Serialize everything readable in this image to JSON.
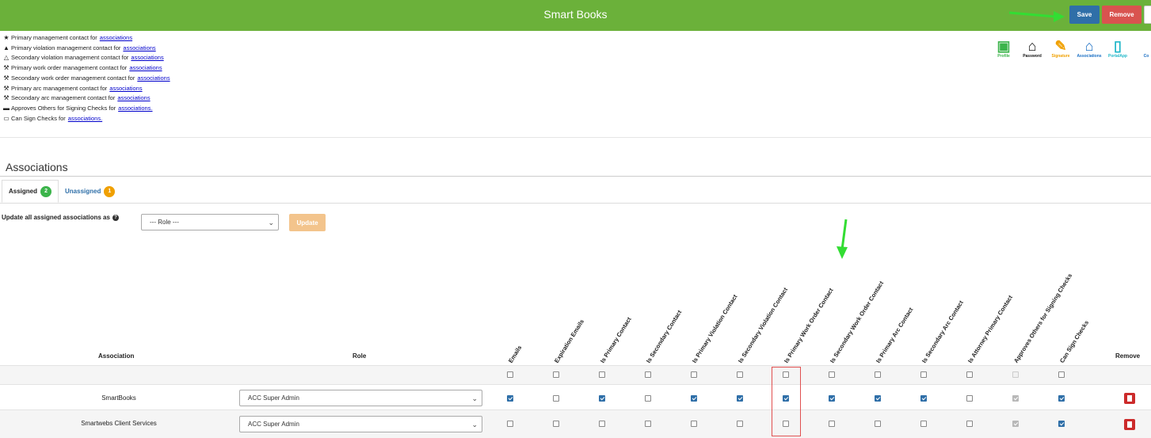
{
  "header": {
    "title": "Smart Books",
    "save_label": "Save",
    "remove_label": "Remove",
    "bg_color": "#6bb13a"
  },
  "legend": [
    {
      "icon": "star-icon",
      "text": "Primary management contact for",
      "link": "associations"
    },
    {
      "icon": "warning-filled-icon",
      "text": "Primary violation management contact for",
      "link": "associations"
    },
    {
      "icon": "warning-outline-icon",
      "text": "Secondary violation management contact for",
      "link": "associations"
    },
    {
      "icon": "wrench-filled-icon",
      "text": "Primary work order management contact for",
      "link": "associations"
    },
    {
      "icon": "wrench-outline-icon",
      "text": "Secondary work order management contact for",
      "link": "associations"
    },
    {
      "icon": "hammer-filled-icon",
      "text": "Primary arc management contact for",
      "link": "associations"
    },
    {
      "icon": "hammer-outline-icon",
      "text": "Secondary arc management contact for",
      "link": "associations"
    },
    {
      "icon": "money-icon",
      "text": "Approves Others for Signing Checks for",
      "link": "associations."
    },
    {
      "icon": "check-card-icon",
      "text": "Can Sign Checks for",
      "link": "associations."
    }
  ],
  "tools": [
    {
      "label": "Profile",
      "icon": "profile-card-icon",
      "color": "#3cb44b"
    },
    {
      "label": "Password",
      "icon": "password-building-icon",
      "color": "#111111"
    },
    {
      "label": "Signature",
      "icon": "pencil-icon",
      "color": "#f0a000"
    },
    {
      "label": "Associations",
      "icon": "home-icon",
      "color": "#1a6fc4"
    },
    {
      "label": "PortalApp",
      "icon": "mobile-icon",
      "color": "#1fb6c8"
    },
    {
      "label": "Co",
      "icon": "",
      "color": "#1a6fc4"
    }
  ],
  "section": {
    "title": "Associations"
  },
  "tabs": [
    {
      "label": "Assigned",
      "count": "2",
      "active": true
    },
    {
      "label": "Unassigned",
      "count": "1",
      "active": false
    }
  ],
  "bulk": {
    "label": "Update all assigned associations as",
    "select_value": "--- Role ---",
    "update_label": "Update"
  },
  "table": {
    "col_association": "Association",
    "col_role": "Role",
    "col_remove": "Remove",
    "checkbox_columns": [
      "Emails",
      "Expiration Emails",
      "Is Primary Contact",
      "Is Secondary Contact",
      "Is Primary Violation Contact",
      "Is Secondary Violation Contact",
      "Is Primary Work Order Contact",
      "Is Secondary Work Order Contact",
      "Is Primary Arc Contact",
      "Is Secondary Arc Contact",
      "Is Attorney Primary Contact",
      "Approves Others for Signing Checks",
      "Can Sign Checks"
    ],
    "filter_row": [
      false,
      false,
      false,
      false,
      false,
      false,
      false,
      false,
      false,
      false,
      false,
      false,
      false
    ],
    "filter_disabled": [
      false,
      false,
      false,
      false,
      false,
      false,
      false,
      false,
      false,
      false,
      false,
      true,
      false
    ],
    "rows": [
      {
        "association": "SmartBooks",
        "role": "ACC Super Admin",
        "checks": [
          true,
          false,
          true,
          false,
          true,
          true,
          true,
          true,
          true,
          true,
          false,
          true,
          true
        ],
        "disabled": [
          false,
          false,
          false,
          false,
          false,
          false,
          false,
          false,
          false,
          false,
          false,
          true,
          false
        ]
      },
      {
        "association": "Smartwebs Client Services",
        "role": "ACC Super Admin",
        "checks": [
          false,
          false,
          false,
          false,
          false,
          false,
          false,
          false,
          false,
          false,
          false,
          true,
          true
        ],
        "disabled": [
          false,
          false,
          false,
          false,
          false,
          false,
          false,
          false,
          false,
          false,
          false,
          true,
          false
        ]
      }
    ]
  }
}
